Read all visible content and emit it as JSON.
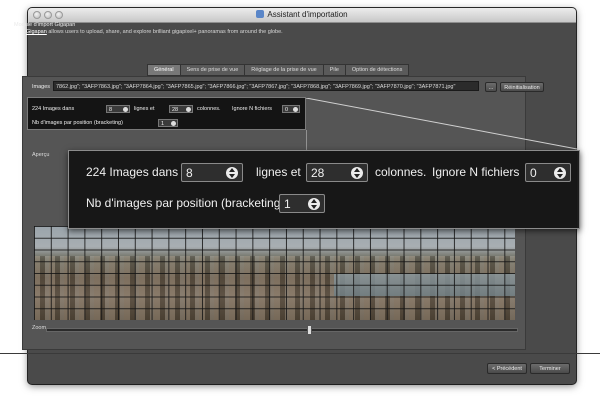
{
  "window": {
    "title": "Assistant d'importation"
  },
  "header": {
    "module_title": "Module d'import Gigapan",
    "link_text": "Gigapan",
    "description": " allows users to upload, share, and explore brilliant gigapixel+ panoramas from around the globe."
  },
  "tabs": [
    {
      "label": "Général",
      "active": true
    },
    {
      "label": "Sens de prise de vue",
      "active": false
    },
    {
      "label": "Réglage de la prise de vue",
      "active": false
    },
    {
      "label": "Pile",
      "active": false
    },
    {
      "label": "Option de détections",
      "active": false
    }
  ],
  "images": {
    "label": "Images",
    "value": "7862.jpg\"; \"3AFP7863.jpg\"; \"3AFP7864.jpg\"; \"3AFP7865.jpg\"; \"3AFP7866.jpg\"; \"3AFP7867.jpg\"; \"3AFP7868.jpg\"; \"3AFP7869.jpg\"; \"3AFP7870.jpg\"; \"3AFP7871.jpg\"",
    "browse_label": "...",
    "reset_label": "Réinitialisation"
  },
  "grid_settings": {
    "images_count_text": "224 Images dans",
    "rows_value": "8",
    "rows_suffix": "lignes et",
    "cols_value": "28",
    "cols_suffix": "colonnes.",
    "ignore_label": "Ignore N fichiers",
    "ignore_value": "0",
    "bracketing_label": "Nb d'images par position (bracketing)",
    "bracketing_value": "1"
  },
  "preview": {
    "label": "Aperçu"
  },
  "zoom": {
    "label": "Zoom",
    "level": 0.56
  },
  "footer": {
    "prev_label": "< Précédent",
    "finish_label": "Terminer"
  }
}
